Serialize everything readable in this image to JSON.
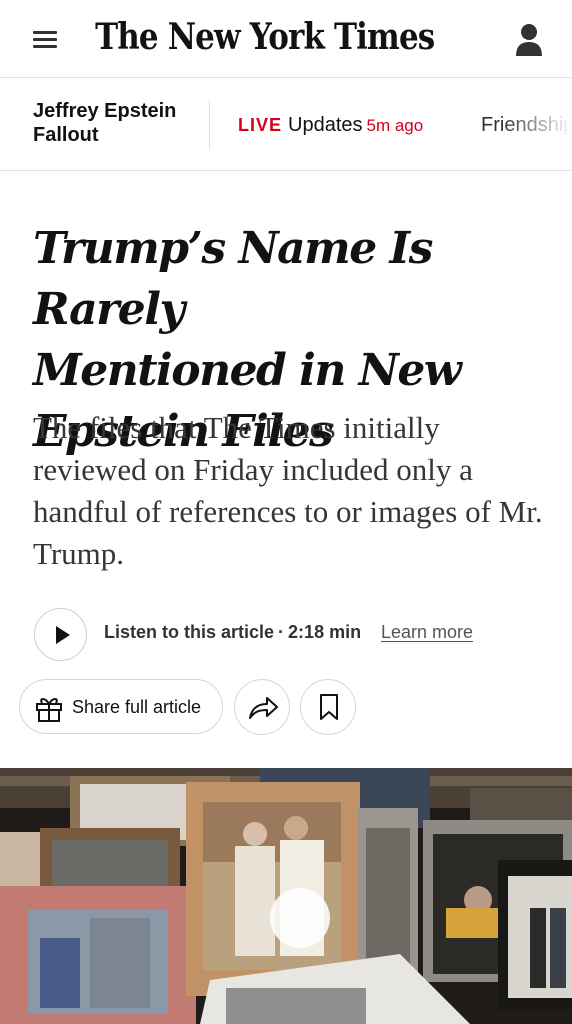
{
  "header": {
    "logo_text": "The New York Times",
    "menu_icon": "hamburger-menu-icon",
    "account_icon": "account-icon"
  },
  "live_strip": {
    "topic": "Jeffrey Epstein Fallout",
    "live_badge": "LIVE",
    "live_label": "Updates",
    "live_time": "5m ago",
    "next_item": "Friendship"
  },
  "article": {
    "headline_lines": [
      "Trump’s Name Is Rarely",
      "Mentioned in New",
      "Epstein Files"
    ],
    "summary": "The files that The Times initially reviewed on Friday included only a handful of references to or images of Mr. Trump."
  },
  "listen": {
    "label": "Listen to this article",
    "separator": "·",
    "duration": "2:18 min",
    "learn_more": "Learn more",
    "play_icon": "play-icon"
  },
  "actions": {
    "share_label": "Share full article",
    "gift_icon": "gift-icon",
    "share_icon": "share-arrow-icon",
    "bookmark_icon": "bookmark-icon"
  },
  "colors": {
    "live_red": "#d0021b",
    "text": "#121212",
    "border": "#e2e2e2"
  }
}
